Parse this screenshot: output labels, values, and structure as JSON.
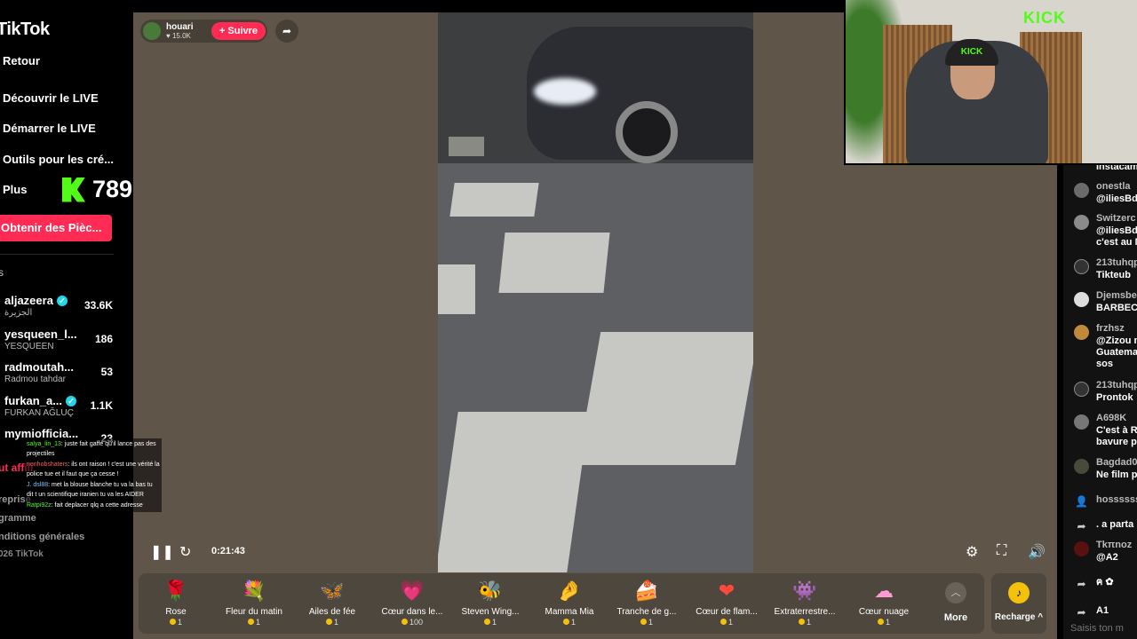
{
  "sidebar": {
    "logo": "TikTok",
    "nav": [
      "Retour",
      "Découvrir le LIVE",
      "Démarrer le LIVE",
      "Outils pour les cré...",
      "Plus"
    ],
    "coins_button": "Obtenir des Pièc...",
    "section_marker": "s",
    "accounts": [
      {
        "name": "aljazeera",
        "sub": "الجزيرة",
        "count": "33.6K",
        "verified": true
      },
      {
        "name": "yesqueen_l...",
        "sub": "YESQUEEN",
        "count": "186",
        "verified": false
      },
      {
        "name": "radmoutah...",
        "sub": "Radmou tahdar",
        "count": "53",
        "verified": false
      },
      {
        "name": "furkan_a...",
        "sub": "FURKAN AĞLUÇ",
        "count": "1.1K",
        "verified": true
      },
      {
        "name": "mymiofficia...",
        "sub": "",
        "count": "23",
        "verified": false
      }
    ],
    "live_red": "ut affili",
    "footer": [
      "reprise",
      "gramme",
      "nditions générales",
      "026 TikTok"
    ]
  },
  "kick_counter": {
    "value": "789",
    "color": "#53fc18"
  },
  "overlay_chat": [
    {
      "user": "salya_lin_13",
      "text": ": juste fait gaffe qu'il lance pas des projectiles",
      "style": ""
    },
    {
      "user": "nonhobshaters",
      "text": ": ils ont raison ! c'est une vérité la police tue et il faut que ça cesse !",
      "style": "red"
    },
    {
      "user": "J. dsl88",
      "text": ": met la blouse blanche tu va la bas tu dit t un scientifique iranien tu va les AIDER",
      "style": "blue"
    },
    {
      "user": "Ratpi92z",
      "text": ": fait deplacer qlq a cette adresse",
      "style": ""
    }
  ],
  "host": {
    "name": "houari",
    "likes": "♥ 15.0K",
    "follow": "+ Suivre"
  },
  "player": {
    "time": "0:21:43"
  },
  "gifts": [
    {
      "name": "Rose",
      "price": "1",
      "icon": "🌹"
    },
    {
      "name": "Fleur du matin",
      "price": "1",
      "icon": "💐"
    },
    {
      "name": "Ailes de fée",
      "price": "1",
      "icon": "🦋"
    },
    {
      "name": "Cœur dans le...",
      "price": "100",
      "icon": "💗"
    },
    {
      "name": "Steven Wing...",
      "price": "1",
      "icon": "🐝"
    },
    {
      "name": "Mamma Mia",
      "price": "1",
      "icon": "🤌"
    },
    {
      "name": "Tranche de g...",
      "price": "1",
      "icon": "🍰"
    },
    {
      "name": "Cœur de flam...",
      "price": "1",
      "icon": "❤"
    },
    {
      "name": "Extraterrestre...",
      "price": "1",
      "icon": "👾"
    },
    {
      "name": "Cœur nuage",
      "price": "1",
      "icon": "☁"
    }
  ],
  "more_label": "More",
  "recharge_label": "Recharge ^",
  "webcam": {
    "sign": "KICK",
    "cap": "KICK"
  },
  "chat": [
    {
      "user": "",
      "msg": "Instacam"
    },
    {
      "user": "onestla",
      "msg": "@iliesBdz"
    },
    {
      "user": "Switzerc",
      "msg": "@iliesBdz\nc'est au M"
    },
    {
      "user": "213tuhqp",
      "msg": "Tikteub"
    },
    {
      "user": "Djemsbe",
      "msg": "BARBECU"
    },
    {
      "user": "frzhsz",
      "msg": "@Zizou n\nGuatema\nsos"
    },
    {
      "user": "213tuhqp",
      "msg": "Prontok"
    },
    {
      "user": "A698K",
      "msg": "C'est à R\nbavure p"
    },
    {
      "user": "Bagdad0",
      "msg": "Ne film p"
    },
    {
      "user": "hossssss",
      "msg": ""
    },
    {
      "user": "",
      "msg": ". a parta"
    },
    {
      "user": "Tkπnoz",
      "msg": "@A2"
    },
    {
      "user": "",
      "msg": "ฅ ✿"
    },
    {
      "user": "",
      "msg": "A1"
    }
  ],
  "chat_input_placeholder": "Saisis ton m"
}
